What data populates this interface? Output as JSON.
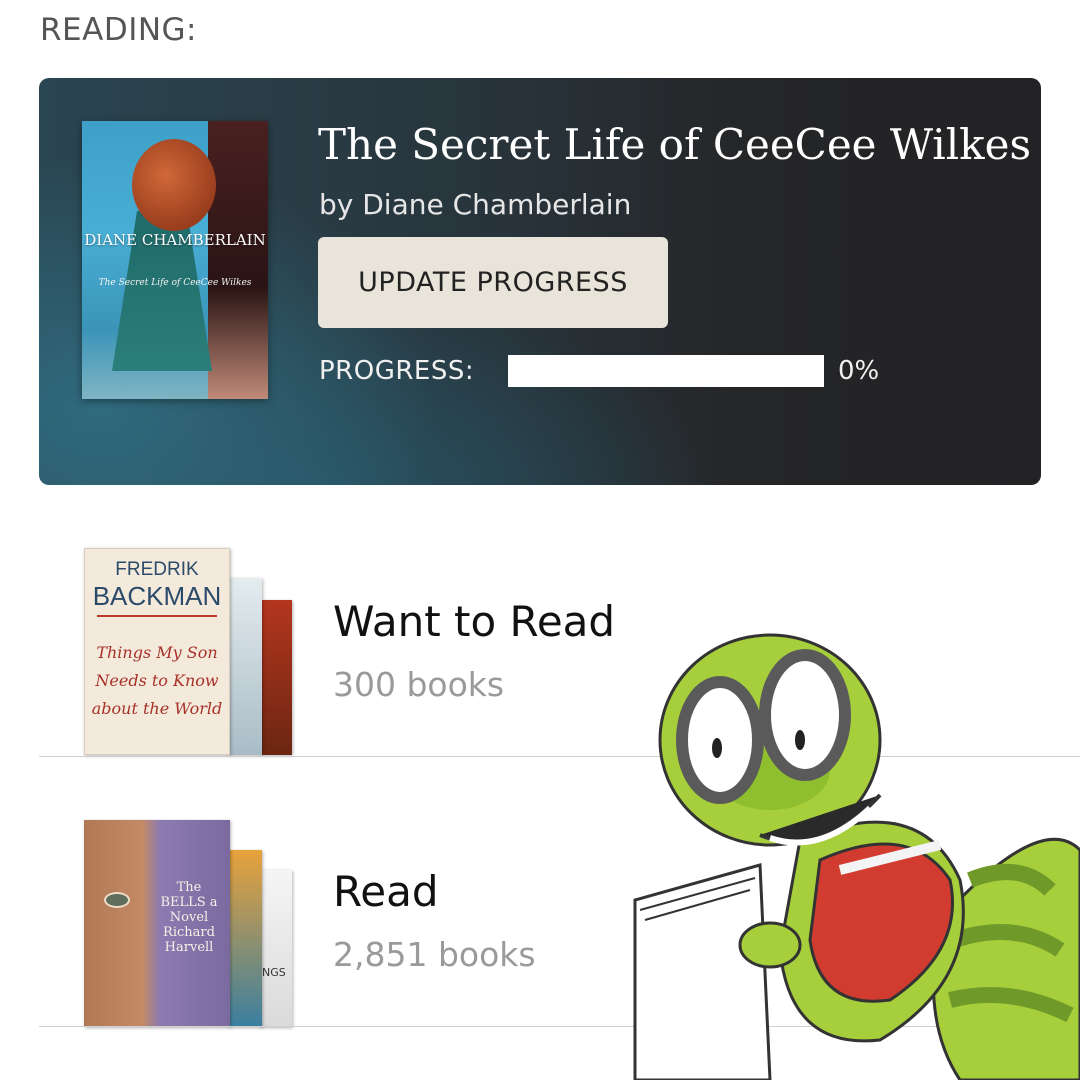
{
  "reading": {
    "section_label": "READING:",
    "book": {
      "title": "The Secret Life of CeeCee Wilkes",
      "author_line": "by Diane Chamberlain",
      "cover_author": "DIANE CHAMBERLAIN",
      "cover_title": "The Secret Life of CeeCee Wilkes"
    },
    "update_button_label": "UPDATE PROGRESS",
    "progress_label": "PROGRESS:",
    "progress_value": 0,
    "progress_text": "0%"
  },
  "shelves": [
    {
      "name": "Want to Read",
      "count": "300 books",
      "front_cover": {
        "author_first": "FREDRIK",
        "author_last": "BACKMAN",
        "title": "Things My Son Needs to Know about the World"
      }
    },
    {
      "name": "Read",
      "count": "2,851 books",
      "front_cover": {
        "title": "The BELLS a Novel Richard Harvell",
        "back_cover_text": "NGS"
      }
    }
  ],
  "icons": {
    "mascot": "bookworm-mascot-icon"
  },
  "colors": {
    "card_background": "#252628",
    "button_background": "#e8e4da",
    "progress_track": "#ffffff",
    "count_text": "#9a9a9a",
    "mascot_body": "#a6cf3b",
    "mascot_shirt": "#d23c30"
  }
}
